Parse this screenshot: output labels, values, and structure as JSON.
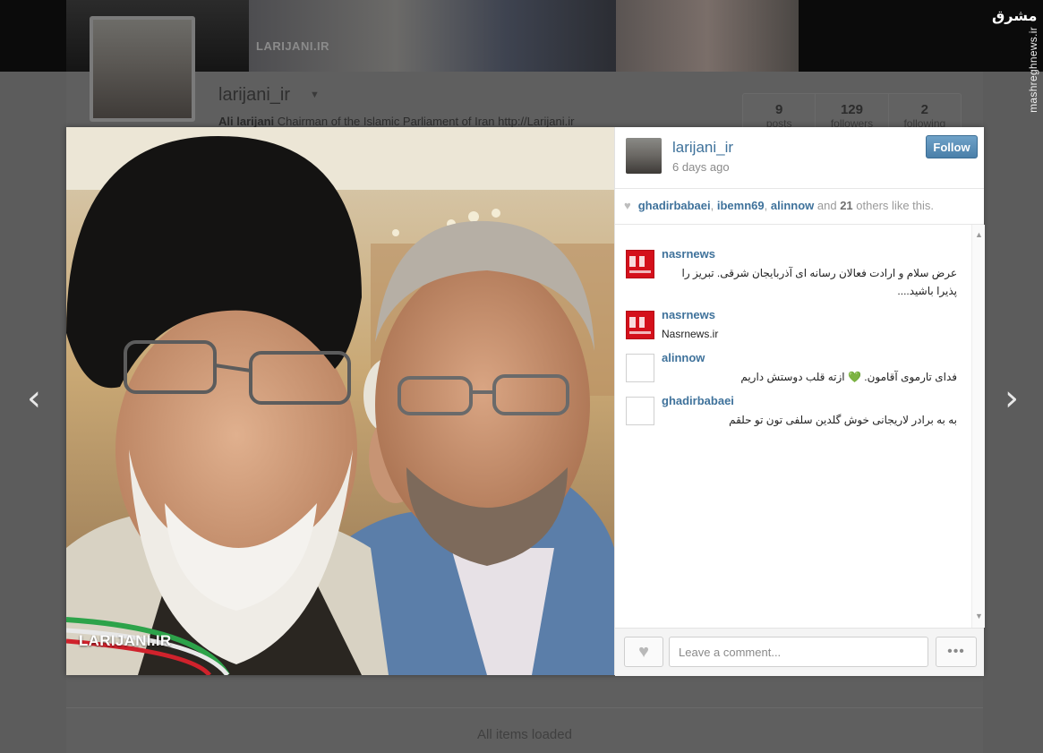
{
  "background": {
    "cover_text": "LARIJANI.IR",
    "username": "larijani_ir",
    "bio_name": "Ali larijani",
    "bio_text": "Chairman of the Islamic Parliament of Iran http://Larijani.ir",
    "stats": [
      {
        "value": "9",
        "label": "posts"
      },
      {
        "value": "129",
        "label": "followers"
      },
      {
        "value": "2",
        "label": "following"
      }
    ],
    "footer_text": "All items loaded",
    "watermark": "مشرق",
    "watermark_side": "mashreghnews.ir"
  },
  "nav": {
    "prev_glyph": "‹",
    "next_glyph": "›"
  },
  "modal": {
    "photo_logo": "LARIJANI.IR",
    "owner": {
      "username": "larijani_ir",
      "time": "6 days ago"
    },
    "follow_label": "Follow",
    "likes": {
      "users": [
        "ghadirbabaei",
        "ibemn69",
        "alinnow"
      ],
      "and_text": "and",
      "count": "21",
      "suffix": "others like this."
    },
    "comments": [
      {
        "user": "nasrnews",
        "avatar": "red",
        "text": "عرض سلام و ارادت فعالان رسانه ای آذربایجان شرقی. تبریز را پذیرا باشید....",
        "dir": "rtl"
      },
      {
        "user": "nasrnews",
        "avatar": "red",
        "text": "Nasrnews.ir",
        "dir": "ltr"
      },
      {
        "user": "alinnow",
        "avatar": "blank",
        "text": "فدای تارموی آقامون. 💚 ازته قلب دوستش داریم",
        "dir": "rtl"
      },
      {
        "user": "ghadirbabaei",
        "avatar": "blank",
        "text": "به به برادر لاریجانی خوش گلدین سلفی تون تو حلقم",
        "dir": "rtl"
      }
    ],
    "comment_placeholder": "Leave a comment...",
    "more_glyph": "•••",
    "like_glyph": "♥",
    "scroll_up_glyph": "▲",
    "scroll_down_glyph": "▼"
  }
}
